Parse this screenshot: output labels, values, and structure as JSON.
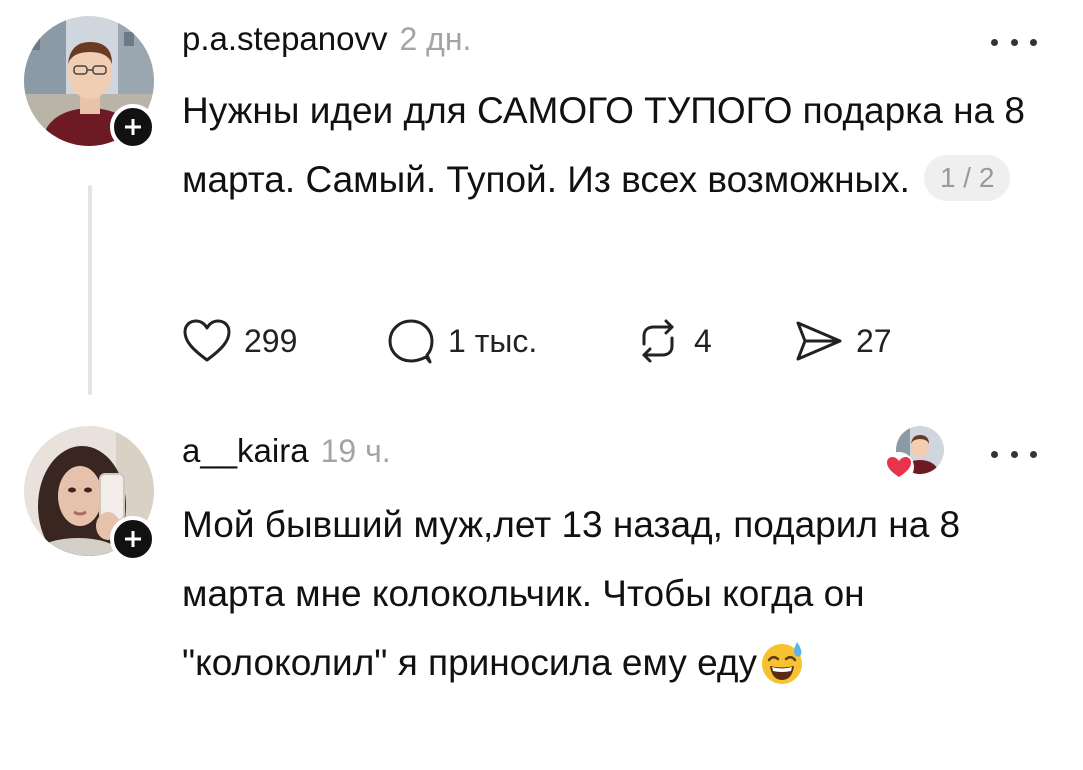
{
  "posts": [
    {
      "username": "p.a.stepanovv",
      "time": "2 дн.",
      "text": "Нужны идеи для САМОГО ТУПОГО подарка на 8 марта. Самый. Тупой. Из всех возможных.",
      "pager": "1 / 2",
      "actions": {
        "likes": "299",
        "replies": "1 тыс.",
        "reposts": "4",
        "shares": "27"
      }
    },
    {
      "username": "a__kaira",
      "time": "19 ч.",
      "text": "Мой бывший муж,лет 13 назад, подарил на 8 марта мне колокольчик. Чтобы когда он \"колоколил\" я приносила ему еду",
      "emoji": "sweat-smile-emoji"
    }
  ],
  "colors": {
    "text": "#111111",
    "muted": "#a4a4a4",
    "like_heart": "#e8344a",
    "thread_line": "#e3e3e3"
  }
}
